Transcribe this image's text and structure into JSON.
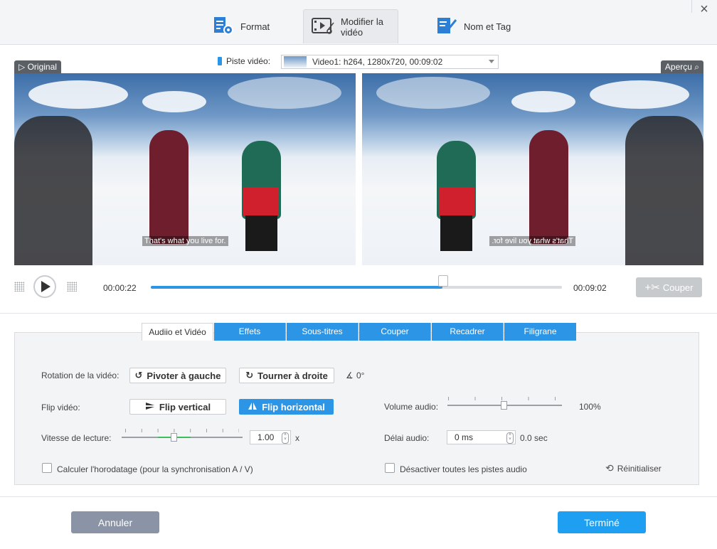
{
  "header": {
    "tabs": [
      {
        "label": "Format",
        "icon": "format-settings-icon"
      },
      {
        "label": "Modifier la vidéo",
        "icon": "video-edit-icon",
        "active": true
      },
      {
        "label": "Nom et Tag",
        "icon": "tag-edit-icon"
      }
    ],
    "close_label": "×"
  },
  "preview": {
    "track_label": "Piste vidéo:",
    "track_value": "Video1: h264, 1280x720, 00:09:02",
    "original_label": "Original",
    "preview_label": "Aperçu",
    "subtitle_text": "That's what you live for."
  },
  "player": {
    "current_time": "00:00:22",
    "total_time": "00:09:02",
    "progress": 0.71,
    "cut_label": "Couper"
  },
  "edit_tabs": [
    "Audiio et Vidéo",
    "Effets",
    "Sous-titres",
    "Couper",
    "Recadrer",
    "Filigrane"
  ],
  "settings": {
    "rotation_label": "Rotation de la vidéo:",
    "rotate_left": "Pivoter à gauche",
    "rotate_right": "Tourner à droite",
    "angle": "0°",
    "flip_label": "Flip vidéo:",
    "flip_vertical": "Flip vertical",
    "flip_horizontal": "Flip horizontal",
    "speed_label": "Vitesse de lecture:",
    "speed_value": "1.00",
    "speed_unit": "x",
    "volume_label": "Volume audio:",
    "volume_value": "100%",
    "delay_label": "Délai audio:",
    "delay_value": "0 ms",
    "delay_sec": "0.0 sec",
    "timestamp_label": "Calculer l'horodatage (pour la synchronisation A / V)",
    "disable_audio_label": "Désactiver toutes les pistes audio",
    "reset_label": "Réinitialiser"
  },
  "footer": {
    "cancel": "Annuler",
    "done": "Terminé"
  },
  "colors": {
    "accent": "#2d95e6",
    "cancel": "#8a94a6",
    "done": "#1e9ff2"
  }
}
